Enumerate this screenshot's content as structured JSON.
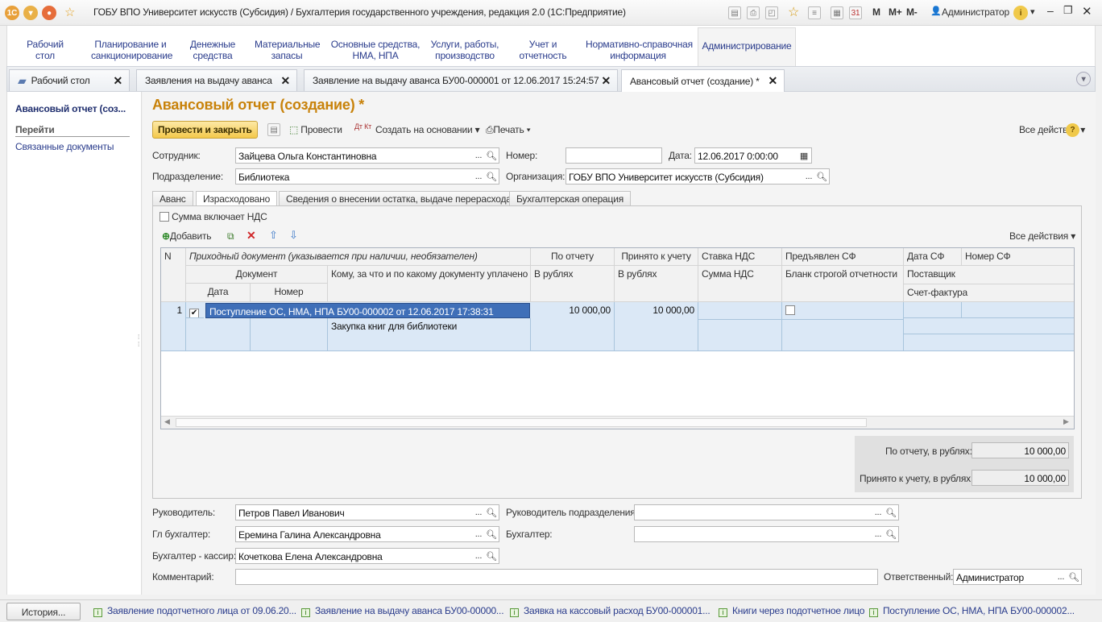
{
  "window": {
    "title": "ГОБУ ВПО Университет искусств (Субсидия) / Бухгалтерия государственного учреждения, редакция 2.0  (1С:Предприятие)",
    "m": "M",
    "mplus": "M+",
    "mminus": "M-",
    "user": "Администратор",
    "cal_day": "31"
  },
  "sections": [
    {
      "label": "Рабочий стол",
      "l1": "Рабочий",
      "l2": "стол"
    },
    {
      "label": "Планирование и санкционирование",
      "l1": "Планирование и",
      "l2": "санкционирование"
    },
    {
      "label": "Денежные средства",
      "l1": "Денежные",
      "l2": "средства"
    },
    {
      "label": "Материальные запасы",
      "l1": "Материальные",
      "l2": "запасы"
    },
    {
      "label": "Основные средства, НМА, НПА",
      "l1": "Основные средства,",
      "l2": "НМА, НПА"
    },
    {
      "label": "Услуги, работы, производство",
      "l1": "Услуги, работы,",
      "l2": "производство"
    },
    {
      "label": "Учет и отчетность",
      "l1": "Учет и",
      "l2": "отчетность"
    },
    {
      "label": "Нормативно-справочная информация",
      "l1": "Нормативно-справочная",
      "l2": "информация"
    },
    {
      "label": "Администрирование",
      "l1": "Администрирование",
      "l2": ""
    }
  ],
  "open_tabs": [
    "Рабочий стол",
    "Заявления на выдачу аванса",
    "Заявление на выдачу аванса БУ00-000001 от 12.06.2017 15:24:57",
    "Авансовый отчет (создание) *"
  ],
  "left_panel": {
    "title": "Авансовый отчет (соз...",
    "goto": "Перейти",
    "link": "Связанные документы"
  },
  "form": {
    "title": "Авансовый отчет (создание) *",
    "toolbar": {
      "post_close": "Провести и закрыть",
      "post": "Провести",
      "create_based": "Создать на основании",
      "print": "Печать",
      "all_actions": "Все действия",
      "dtkt": "Дт Кт"
    },
    "employee_label": "Сотрудник:",
    "employee": "Зайцева Ольга Константиновна",
    "number_label": "Номер:",
    "number": "",
    "date_label": "Дата:",
    "date": "12.06.2017  0:00:00",
    "dept_label": "Подразделение:",
    "dept": "Библиотека",
    "org_label": "Организация:",
    "org": "ГОБУ ВПО Университет искусств (Субсидия)",
    "tabs": [
      "Аванс",
      "Израсходовано",
      "Сведения о внесении остатка, выдаче перерасхода",
      "Бухгалтерская операция"
    ],
    "vat_included": "Сумма включает НДС",
    "add": "Добавить",
    "all_actions": "Все действия",
    "grid": {
      "headers": {
        "n": "N",
        "incoming": "Приходный документ (указывается при наличии, необязателен)",
        "by_report": "По отчету",
        "accepted": "Принято к учету",
        "vat_rate": "Ставка НДС",
        "sf_presented": "Предъявлен СФ",
        "sf_date": "Дата СФ",
        "sf_number": "Номер СФ",
        "document": "Документ",
        "to_whom": "Кому, за что и по какому документу уплачено",
        "rub1": "В рублях",
        "rub2": "В рублях",
        "vat_sum": "Сумма НДС",
        "strict_form": "Бланк строгой отчетности",
        "supplier": "Поставщик",
        "date": "Дата",
        "number": "Номер",
        "invoice": "Счет-фактура"
      },
      "rows": [
        {
          "n": "1",
          "checked": true,
          "document": "Поступление ОС, НМА, НПА БУ00-000002 от 12.06.2017 17:38:31",
          "to_whom": "Закупка книг для библиотеки",
          "by_report": "10 000,00",
          "accepted": "10 000,00",
          "sf_presented": false
        }
      ]
    },
    "totals": {
      "by_report_label": "По отчету, в рублях:",
      "by_report": "10 000,00",
      "accepted_label": "Принято к учету, в рублях:",
      "accepted": "10 000,00"
    },
    "head_label": "Руководитель:",
    "head": "Петров Павел Иванович",
    "dept_head_label": "Руководитель подразделения:",
    "dept_head": "",
    "chief_acc_label": "Гл бухгалтер:",
    "chief_acc": "Еремина Галина Александровна",
    "acc_label": "Бухгалтер:",
    "acc": "",
    "cashier_label": "Бухгалтер - кассир:",
    "cashier": "Кочеткова Елена Александровна",
    "comment_label": "Комментарий:",
    "comment": "",
    "responsible_label": "Ответственный:",
    "responsible": "Администратор"
  },
  "bottom": {
    "history": "История...",
    "items": [
      "Заявление подотчетного лица от 09.06.20...",
      "Заявление на выдачу аванса БУ00-00000...",
      "Заявка на кассовый расход БУ00-000001...",
      "Книги через подотчетное лицо",
      "Поступление ОС, НМА, НПА БУ00-000002..."
    ]
  },
  "colors": {
    "accent_title": "#c8820a",
    "link": "#2a3c8c",
    "selection": "#dbe8f6",
    "selected_cell": "#3f6fb8"
  }
}
